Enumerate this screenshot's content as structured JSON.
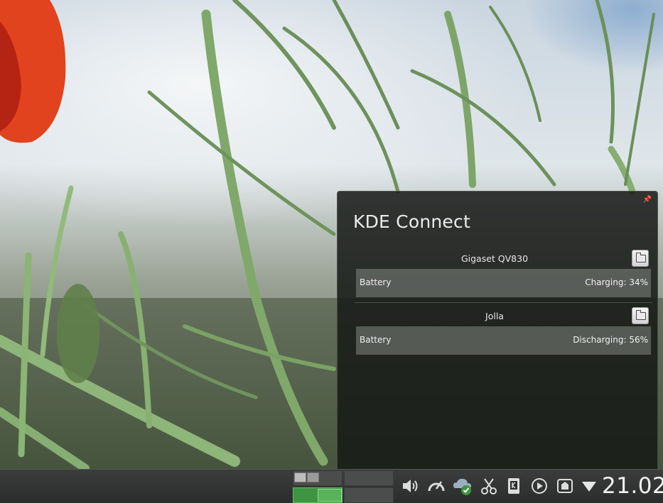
{
  "popup": {
    "title": "KDE Connect",
    "pin_icon": "pin-icon",
    "devices": [
      {
        "name": "Gigaset QV830",
        "battery_label": "Battery",
        "battery_status": "Charging: 34%",
        "browse_icon": "folder-icon"
      },
      {
        "name": "Jolla",
        "battery_label": "Battery",
        "battery_status": "Discharging: 56%",
        "browse_icon": "folder-icon"
      }
    ]
  },
  "panel": {
    "clock": "21.02",
    "tray_icons": [
      "speaker-icon",
      "performance-gauge-icon",
      "cloud-sync-icon",
      "scissors-icon",
      "kdeconnect-phone-icon",
      "play-icon",
      "removable-device-icon",
      "show-hidden-arrow-icon"
    ],
    "pager_desktops": [
      "desktop-1",
      "desktop-2",
      "desktop-3",
      "desktop-4"
    ],
    "active_desktop": "desktop-3"
  },
  "colors": {
    "accent": "#3f9441",
    "popup_bg": "#161816",
    "row_bg": "#82867f"
  }
}
